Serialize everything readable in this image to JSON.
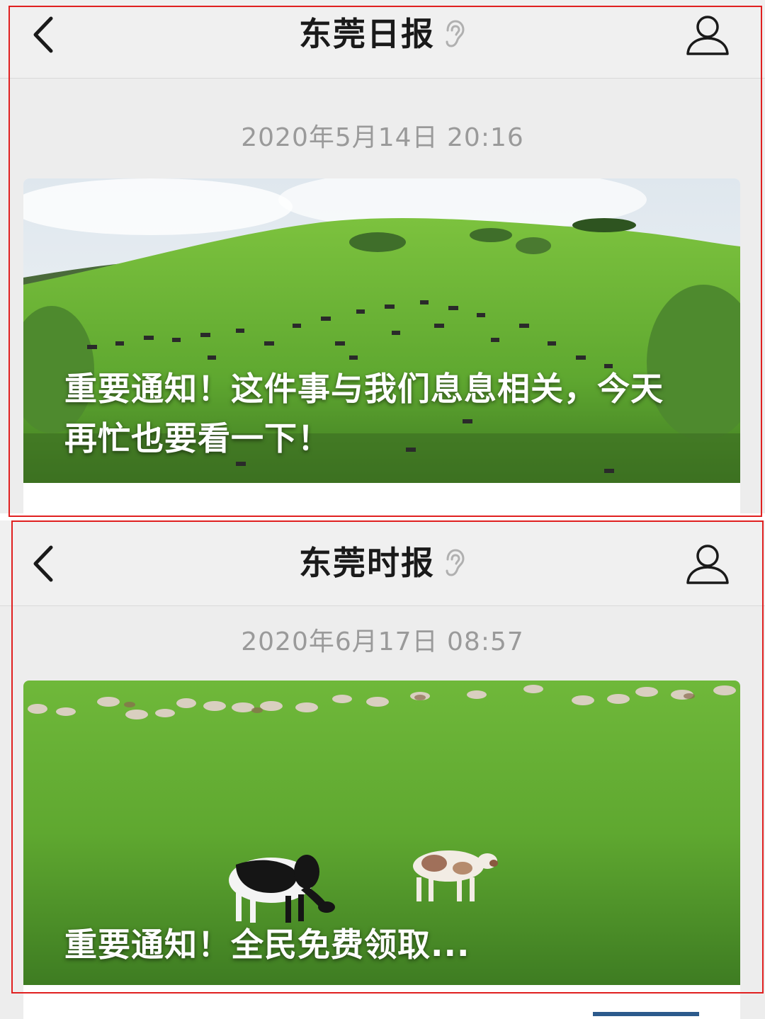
{
  "colors": {
    "highlight_border": "#e02020",
    "timestamp_text": "#9a9a9a",
    "title_text": "#1a1a1a",
    "panel_bg": "#ededed",
    "grass_green": "#5fa830"
  },
  "posts": [
    {
      "header": {
        "back_icon": "chevron-left-icon",
        "account_name": "东莞日报",
        "ear_icon": "ear-icon",
        "profile_icon": "user-outline-icon"
      },
      "timestamp": "2020年5月14日 20:16",
      "article": {
        "cover_scene": "green hillside with grazing cattle",
        "title": "重要通知！这件事与我们息息相关，今天再忙也要看一下！"
      }
    },
    {
      "header": {
        "back_icon": "chevron-left-icon",
        "account_name": "东莞时报",
        "ear_icon": "ear-icon",
        "profile_icon": "user-outline-icon"
      },
      "timestamp": "2020年6月17日 08:57",
      "article": {
        "cover_scene": "flat grassland with sheep and two cows",
        "title": "重要通知！全民免费领取..."
      }
    }
  ]
}
